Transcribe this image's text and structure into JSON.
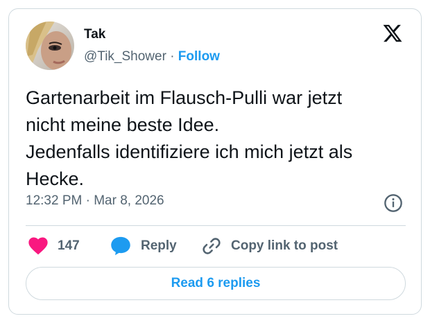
{
  "author": {
    "name": "Tak",
    "handle": "@Tik_Shower",
    "separator": "·",
    "follow_label": "Follow"
  },
  "tweet": {
    "lines": [
      "Gartenarbeit im Flausch-Pulli war jetzt",
      "nicht meine beste Idee.",
      "Jedenfalls identifiziere ich mich jetzt als",
      "Hecke."
    ],
    "timestamp": "12:32 PM · Mar 8, 2026"
  },
  "actions": {
    "like_count": "147",
    "reply_label": "Reply",
    "copy_label": "Copy link to post"
  },
  "read_replies_label": "Read 6 replies",
  "icons": {
    "brand": "x-logo-icon",
    "info": "info-icon",
    "like": "heart-icon",
    "reply": "speech-bubble-icon",
    "copy": "link-icon"
  },
  "colors": {
    "accent": "#1d9bf0",
    "like": "#f91880",
    "muted_text": "#536471",
    "border": "#cfd9de"
  }
}
